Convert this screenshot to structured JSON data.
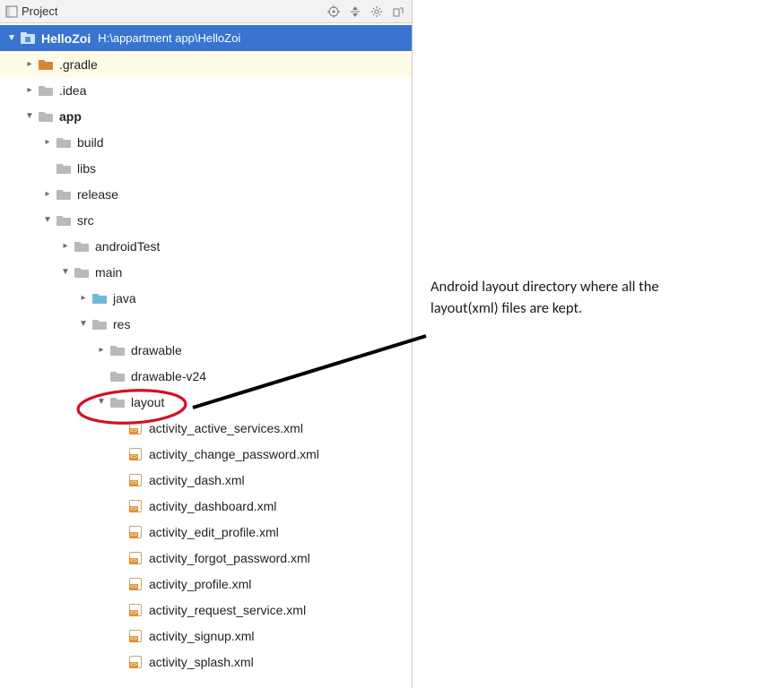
{
  "panel": {
    "title": "Project",
    "root": {
      "name": "HelloZoi",
      "path": "H:\\appartment app\\HelloZoi"
    }
  },
  "tree": [
    {
      "label": ".gradle",
      "depth": 1,
      "arrow": "right",
      "fill": "#d68438",
      "highlight": true
    },
    {
      "label": ".idea",
      "depth": 1,
      "arrow": "right",
      "fill": "#b9b9b9"
    },
    {
      "label": "app",
      "depth": 1,
      "arrow": "down",
      "fill": "#b9b9b9",
      "bold": true
    },
    {
      "label": "build",
      "depth": 2,
      "arrow": "right",
      "fill": "#b9b9b9"
    },
    {
      "label": "libs",
      "depth": 2,
      "arrow": "none",
      "fill": "#b9b9b9"
    },
    {
      "label": "release",
      "depth": 2,
      "arrow": "right",
      "fill": "#b9b9b9"
    },
    {
      "label": "src",
      "depth": 2,
      "arrow": "down",
      "fill": "#b9b9b9"
    },
    {
      "label": "androidTest",
      "depth": 3,
      "arrow": "right",
      "fill": "#b9b9b9"
    },
    {
      "label": "main",
      "depth": 3,
      "arrow": "down",
      "fill": "#b9b9b9"
    },
    {
      "label": "java",
      "depth": 4,
      "arrow": "right",
      "fill": "#6fb7d6"
    },
    {
      "label": "res",
      "depth": 4,
      "arrow": "down",
      "fill": "#b9b9b9"
    },
    {
      "label": "drawable",
      "depth": 5,
      "arrow": "right",
      "fill": "#b9b9b9"
    },
    {
      "label": "drawable-v24",
      "depth": 5,
      "arrow": "none",
      "fill": "#b9b9b9"
    },
    {
      "label": "layout",
      "depth": 5,
      "arrow": "down",
      "fill": "#b9b9b9"
    },
    {
      "label": "activity_active_services.xml",
      "depth": 6,
      "arrow": "none",
      "type": "xml"
    },
    {
      "label": "activity_change_password.xml",
      "depth": 6,
      "arrow": "none",
      "type": "xml"
    },
    {
      "label": "activity_dash.xml",
      "depth": 6,
      "arrow": "none",
      "type": "xml"
    },
    {
      "label": "activity_dashboard.xml",
      "depth": 6,
      "arrow": "none",
      "type": "xml"
    },
    {
      "label": "activity_edit_profile.xml",
      "depth": 6,
      "arrow": "none",
      "type": "xml"
    },
    {
      "label": "activity_forgot_password.xml",
      "depth": 6,
      "arrow": "none",
      "type": "xml"
    },
    {
      "label": "activity_profile.xml",
      "depth": 6,
      "arrow": "none",
      "type": "xml"
    },
    {
      "label": "activity_request_service.xml",
      "depth": 6,
      "arrow": "none",
      "type": "xml"
    },
    {
      "label": "activity_signup.xml",
      "depth": 6,
      "arrow": "none",
      "type": "xml"
    },
    {
      "label": "activity_splash.xml",
      "depth": 6,
      "arrow": "none",
      "type": "xml"
    }
  ],
  "annotation": {
    "line1": "Android layout directory where all the",
    "line2": "layout(xml) files are kept."
  }
}
